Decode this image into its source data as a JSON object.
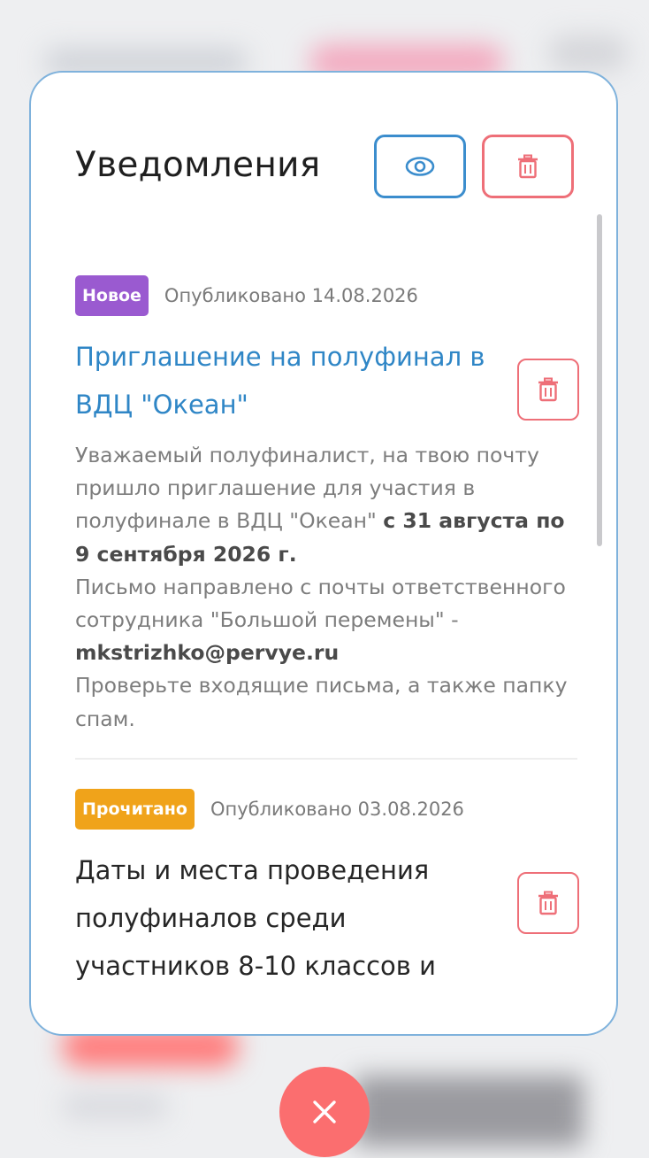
{
  "dialog": {
    "title": "Уведомления",
    "mark_read_icon": "eye-icon",
    "delete_all_icon": "trash-icon"
  },
  "notifications": [
    {
      "status": "Новое",
      "status_color": "#9a5ad0",
      "published": "Опубликовано 14.08.2026",
      "title": "Приглашение на полуфинал в ВДЦ \"Океан\"",
      "title_color": "#2f86c6",
      "body": {
        "p1": "Уважаемый полуфиналист, на твою почту пришло приглашение для участия в полуфинале в ВДЦ \"Океан\" ",
        "p1_bold": "с 31 августа по 9 сентября 2026 г.",
        "p2": "Письмо направлено с почты ответственного сотрудника \"Большой перемены\" - ",
        "p2_bold": "mkstrizhko@pervye.ru",
        "p3": "Проверьте входящие письма, а также папку спам."
      }
    },
    {
      "status": "Прочитано",
      "status_color": "#f0a31a",
      "published": "Опубликовано 03.08.2026",
      "title": "Даты и места проведения полуфиналов среди участников 8-10 классов и"
    }
  ],
  "close_icon": "close-icon"
}
